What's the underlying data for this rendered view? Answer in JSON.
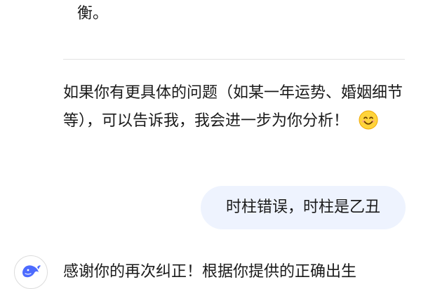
{
  "conversation": {
    "previous_ai_tail": "衡。",
    "ai_paragraph": "如果你有更具体的问题（如某一年运势、婚姻细节等），可以告诉我，我会进一步为你分析！",
    "ai_emoji": "smiling-face-emoji",
    "user_message": "时柱错误，时柱是乙丑",
    "next_ai_message_start": "感谢你的再次纠正！根据你提供的正确出生"
  },
  "colors": {
    "user_bubble_bg": "#eef3fe",
    "divider": "#e3e3e3",
    "avatar_whale": "#4d6bfe",
    "emoji_face": "#ffd43b"
  },
  "icons": {
    "avatar": "whale-logo-icon"
  }
}
